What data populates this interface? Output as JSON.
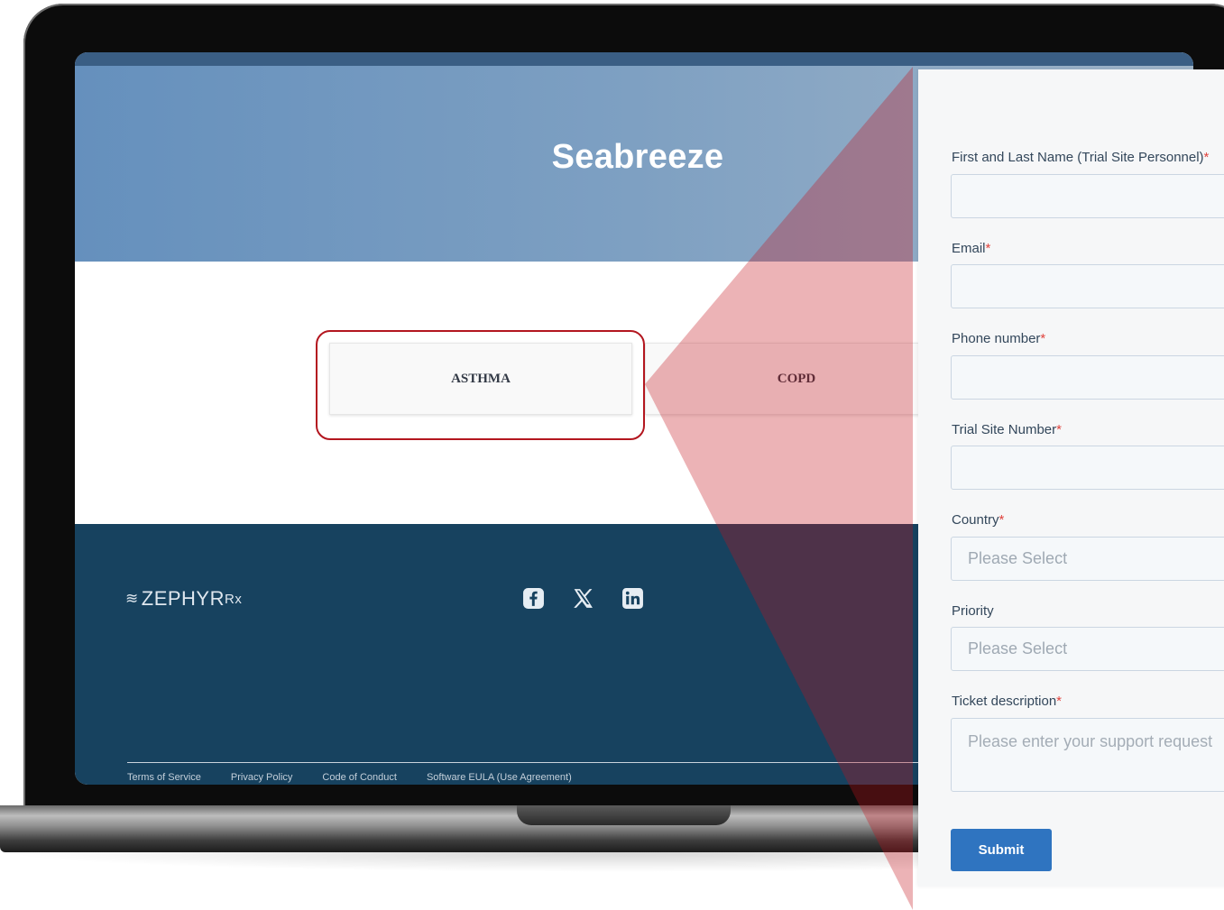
{
  "site": {
    "title": "Seabreeze",
    "cards": [
      {
        "label": "ASTHMA"
      },
      {
        "label": "COPD"
      }
    ],
    "footer": {
      "logo_text": "ZEPHYR",
      "logo_suffix": "Rx",
      "social_icons": [
        "facebook-icon",
        "x-icon",
        "linkedin-icon"
      ],
      "links": [
        "Terms of Service",
        "Privacy Policy",
        "Code of Conduct",
        "Software EULA (Use Agreement)"
      ]
    }
  },
  "form": {
    "fields": [
      {
        "label": "First and Last Name (Trial Site Personnel)",
        "required_mark": "*",
        "value": ""
      },
      {
        "label": "Email",
        "required_mark": "*",
        "value": ""
      },
      {
        "label": "Phone number",
        "required_mark": "*",
        "value": ""
      },
      {
        "label": "Trial Site Number",
        "required_mark": "*",
        "value": ""
      },
      {
        "label": "Country",
        "required_mark": "*",
        "placeholder": "Please Select"
      },
      {
        "label": "Priority",
        "required_mark": "",
        "placeholder": "Please Select"
      },
      {
        "label": "Ticket description",
        "required_mark": "*",
        "placeholder": "Please enter your support request"
      }
    ],
    "submit_label": "Submit"
  },
  "colors": {
    "hero_gradient_start": "#6590bd",
    "footer_bg": "#17425f",
    "callout_red": "#b3161f",
    "submit_blue": "#2f74c0",
    "required_red": "#e0443e"
  }
}
